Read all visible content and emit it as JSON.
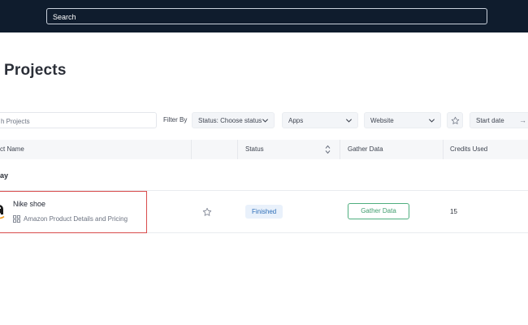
{
  "topbar": {
    "search_placeholder": "Search"
  },
  "page": {
    "title": "Projects"
  },
  "filters": {
    "search_placeholder": "h Projects",
    "filter_by_label": "Filter By",
    "status_dropdown": "Status: Choose status",
    "apps_dropdown": "Apps",
    "website_dropdown": "Website",
    "start_date_label": "Start date",
    "date_arrow": "→"
  },
  "table": {
    "headers": {
      "name": "ct Name",
      "status": "Status",
      "gather": "Gather Data",
      "credits": "Credits Used"
    },
    "group_label": "ay",
    "rows": [
      {
        "name": "Nike shoe",
        "app": "Amazon Product Details and Pricing",
        "status": "Finished",
        "action": "Gather Data",
        "credits": "15"
      }
    ]
  },
  "colors": {
    "topbar": "#0f1c2d",
    "status_badge_bg": "#e9f1fb",
    "status_badge_text": "#2f6fb8",
    "gather_button": "#3f9c6d",
    "highlight": "#d94c4c"
  },
  "icons": [
    "chevron-down-icon",
    "star-icon",
    "sort-icon",
    "grid-icon",
    "amazon-logo"
  ]
}
